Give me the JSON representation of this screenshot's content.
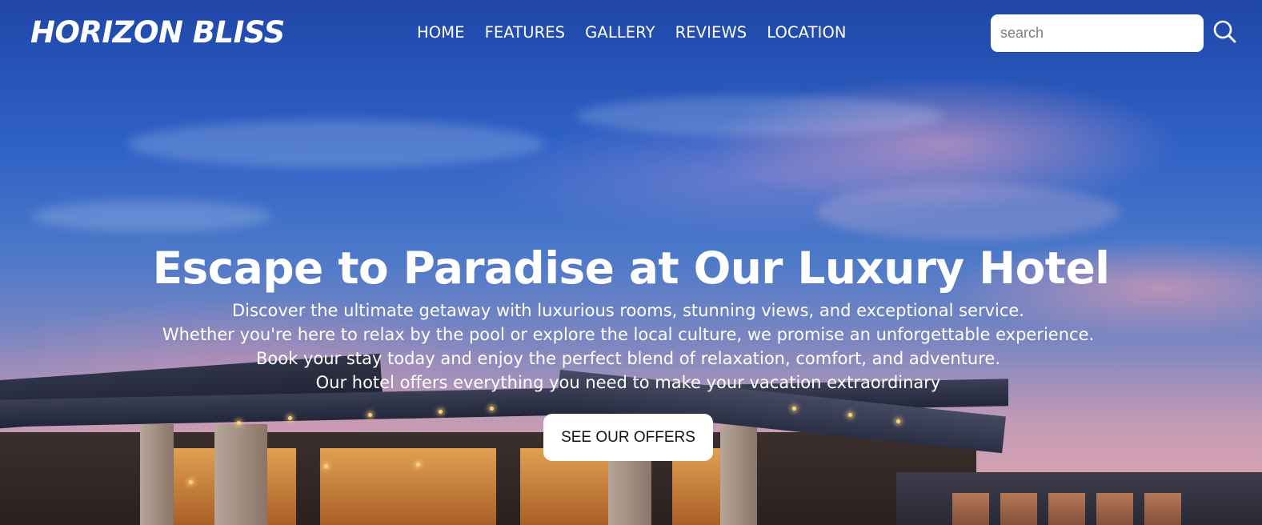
{
  "header": {
    "logo": "HORIZON BLISS",
    "nav": [
      "HOME",
      "FEATURES",
      "GALLERY",
      "REVIEWS",
      "LOCATION"
    ],
    "search": {
      "placeholder": "search",
      "value": "",
      "icon": "search-icon"
    }
  },
  "hero": {
    "headline": "Escape to Paradise at Our Luxury Hotel",
    "tagline_lines": [
      "Discover the ultimate getaway with luxurious rooms, stunning views, and exceptional service.",
      "Whether you're here to relax by the pool or explore the local culture, we promise an unforgettable experience.",
      "Book your stay today and enjoy the perfect blend of relaxation, comfort, and adventure.",
      "Our hotel offers everything you need to make your vacation extraordinary"
    ],
    "cta_label": "SEE OUR OFFERS"
  },
  "colors": {
    "sky_top": "#1f46a8",
    "sky_mid": "#4a78c9",
    "sky_horizon": "#d9a3b0",
    "text": "#ffffff",
    "button_bg": "#ffffff",
    "button_text": "#111111"
  }
}
